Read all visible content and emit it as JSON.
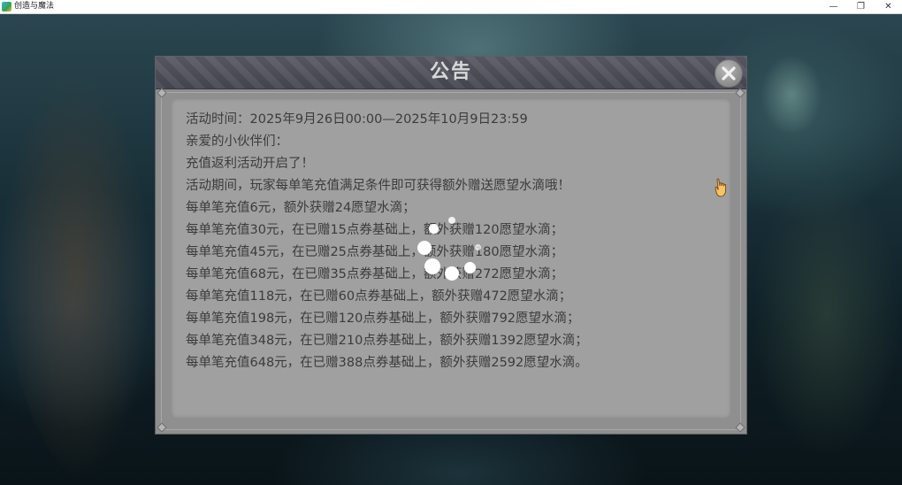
{
  "window": {
    "title": "创造与魔法",
    "minimize_glyph": "—",
    "restore_glyph": "❐",
    "close_glyph": "✕"
  },
  "dialog": {
    "title": "公告",
    "lines": [
      "活动时间：2025年9月26日00:00—2025年10月9日23:59",
      "亲爱的小伙伴们：",
      "充值返利活动开启了！",
      "活动期间，玩家每单笔充值满足条件即可获得额外赠送愿望水滴哦！",
      "每单笔充值6元，额外获赠24愿望水滴；",
      "每单笔充值30元，在已赠15点券基础上，额外获赠120愿望水滴；",
      "每单笔充值45元，在已赠25点券基础上，额外获赠180愿望水滴；",
      "每单笔充值68元，在已赠35点券基础上，额外获赠272愿望水滴；",
      "每单笔充值118元，在已赠60点券基础上，额外获赠472愿望水滴；",
      "每单笔充值198元，在已赠120点券基础上，额外获赠792愿望水滴；",
      "每单笔充值348元，在已赠210点券基础上，额外获赠1392愿望水滴；",
      "每单笔充值648元，在已赠388点券基础上，额外获赠2592愿望水滴。"
    ]
  },
  "icons": {
    "app": "app-logo-icon",
    "close": "close-x-icon",
    "loading": "loading-spinner-icon",
    "cursor": "pointing-hand-cursor-icon"
  },
  "colors": {
    "panel": "#8f8f8f",
    "content": "#a0a0a0",
    "header": "#4f4f5a",
    "text": "#3b3b3b",
    "title": "#d8d8d8"
  }
}
